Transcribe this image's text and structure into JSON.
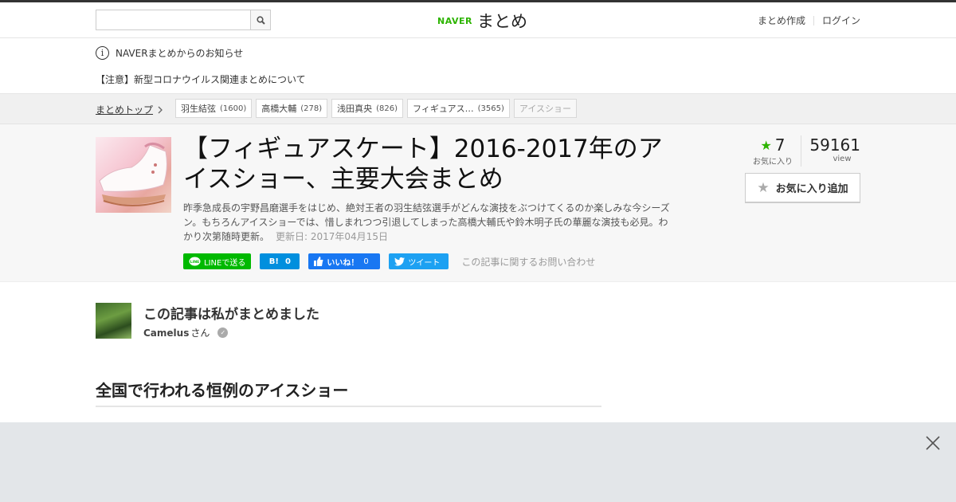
{
  "header": {
    "search": {
      "value": "",
      "placeholder": ""
    },
    "logo": {
      "naver": "NAVER",
      "matome": "まとめ"
    },
    "links": {
      "create": "まとめ作成",
      "login": "ログイン"
    }
  },
  "notice": {
    "heading": "NAVERまとめからのお知らせ",
    "item": "【注意】新型コロナウイルス関連まとめについて"
  },
  "breadcrumb": {
    "top": "まとめトップ",
    "tags": [
      {
        "label": "羽生結弦",
        "count": "(1600)"
      },
      {
        "label": "高橋大輔",
        "count": "(278)"
      },
      {
        "label": "浅田真央",
        "count": "(826)"
      },
      {
        "label": "フィギュアス…",
        "count": "(3565)"
      }
    ],
    "current": "アイスショー"
  },
  "article": {
    "title": "【フィギュアスケート】2016-2017年のアイスショー、主要大会まとめ",
    "description": "昨季急成長の宇野昌磨選手をはじめ、絶対王者の羽生結弦選手がどんな演技をぶつけてくるのか楽しみな今シーズン。もちろんアイスショーでは、惜しまれつつ引退してしまった高橋大輔氏や鈴木明子氏の華麗な演技も必見。わかり次第随時更新。",
    "updated": "更新日: 2017年04月15日"
  },
  "share": {
    "line": "LINEで送る",
    "hatena_icon": "B!",
    "hatena_count": "0",
    "facebook": "いいね！",
    "facebook_count": "0",
    "tweet": "ツイート",
    "contact": "この記事に関するお問い合わせ"
  },
  "stats": {
    "favorites": "7",
    "favorites_label": "お気に入り",
    "views": "59161",
    "views_label": "view",
    "fav_button": "お気に入り追加"
  },
  "author": {
    "heading": "この記事は私がまとめました",
    "name": "Camelus",
    "suffix": "さん"
  },
  "section": {
    "heading": "全国で行われる恒例のアイスショー"
  },
  "colors": {
    "brand": "#2db400",
    "line": "#00b900",
    "hatena": "#008fde",
    "facebook": "#1877f2",
    "twitter": "#1da1f2"
  }
}
